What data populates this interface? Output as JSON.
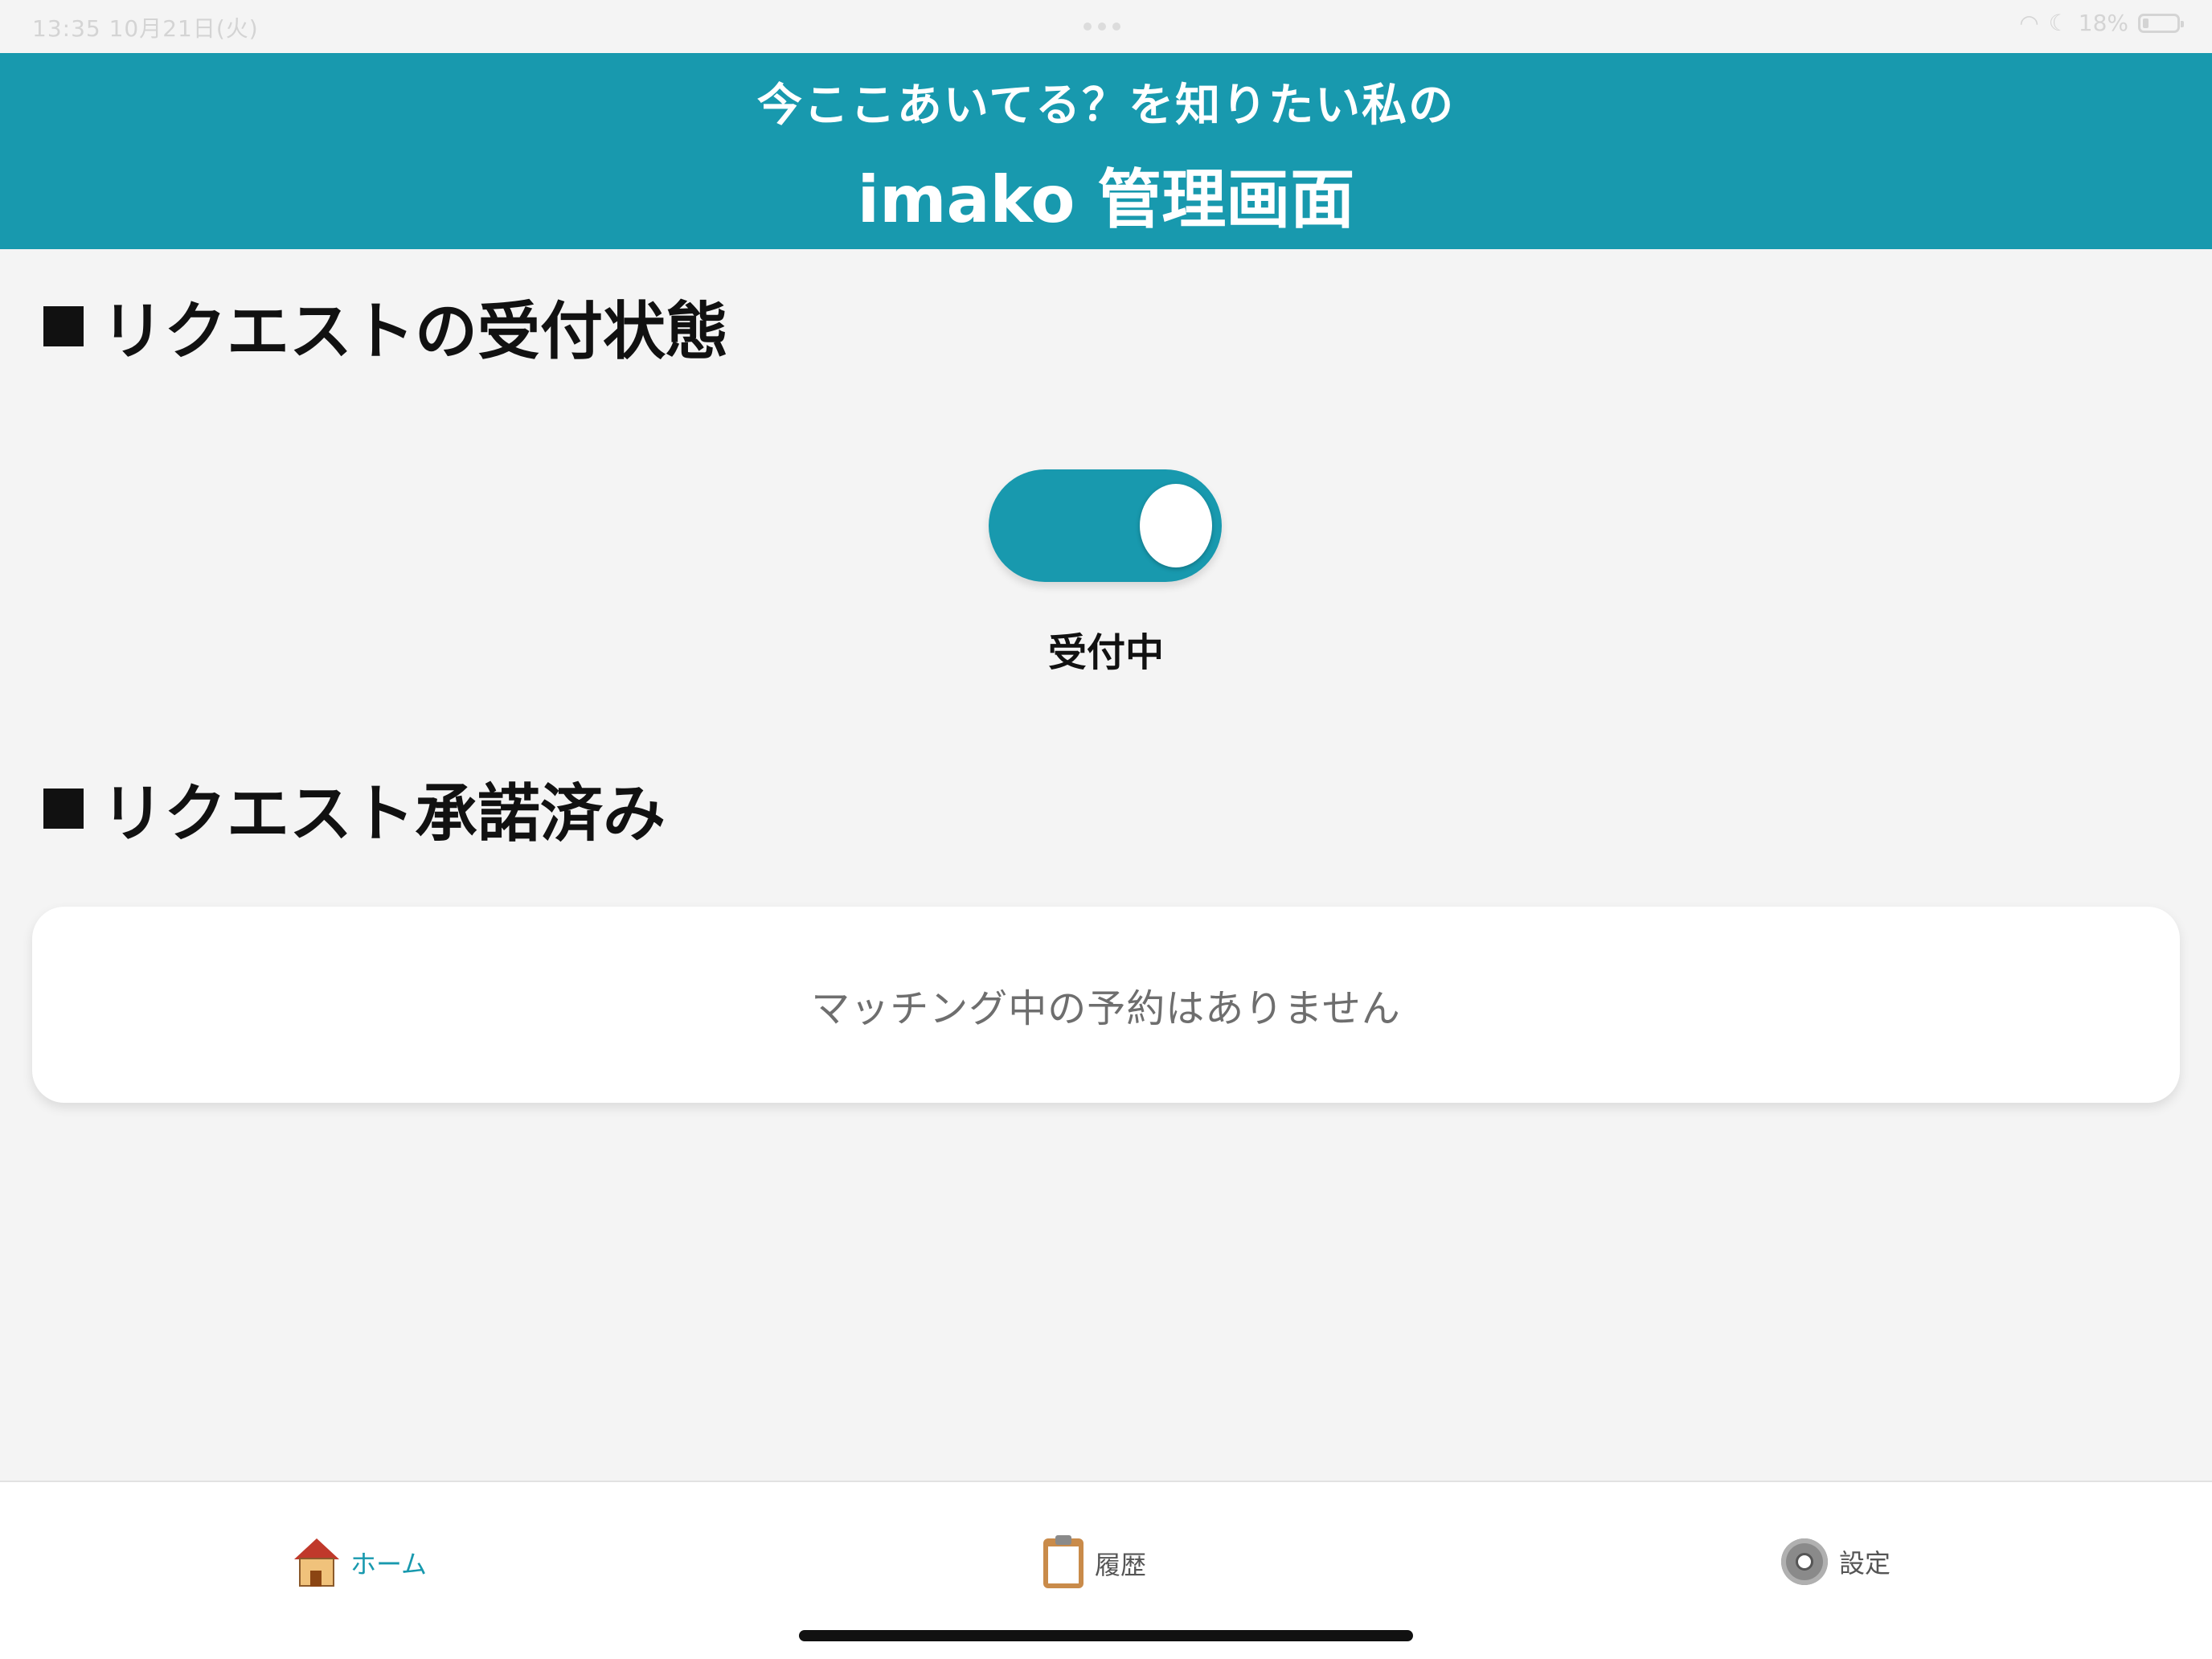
{
  "status_bar": {
    "time_date": "13:35  10月21日(火)",
    "battery": "18%",
    "battery_level": 0.18
  },
  "header": {
    "subtitle": "今ここあいてる？を知りたい私の",
    "title": "imako 管理画面"
  },
  "accept_section": {
    "heading": "リクエストの受付状態",
    "toggle_on": true,
    "toggle_label": "受付中"
  },
  "approved_section": {
    "heading": "リクエスト承諾済み",
    "empty_message": "マッチング中の予約はありません"
  },
  "tab_bar": {
    "items": [
      {
        "label": "ホーム",
        "icon": "house-icon",
        "active": true
      },
      {
        "label": "履歴",
        "icon": "clipboard-icon",
        "active": false
      },
      {
        "label": "設定",
        "icon": "gear-icon",
        "active": false
      }
    ]
  },
  "colors": {
    "accent": "#1899ae",
    "background": "#f4f4f4"
  }
}
